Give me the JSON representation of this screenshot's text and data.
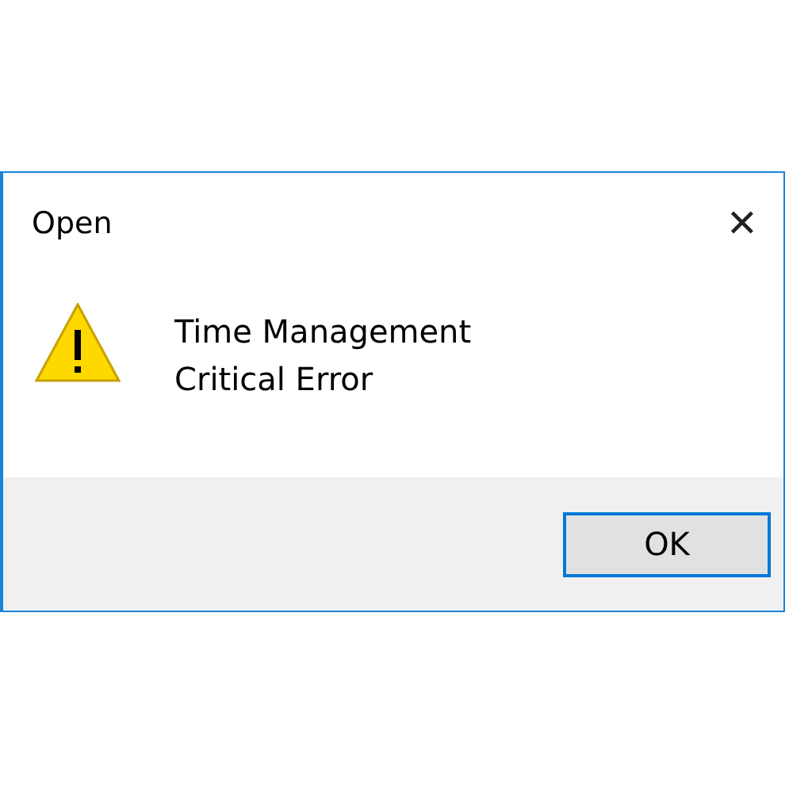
{
  "window": {
    "title": "Open",
    "close": "✕"
  },
  "message": {
    "lines": [
      "Time Management",
      "Critical Error"
    ]
  },
  "buttons": [
    {
      "label": "OK",
      "selected": true
    }
  ]
}
